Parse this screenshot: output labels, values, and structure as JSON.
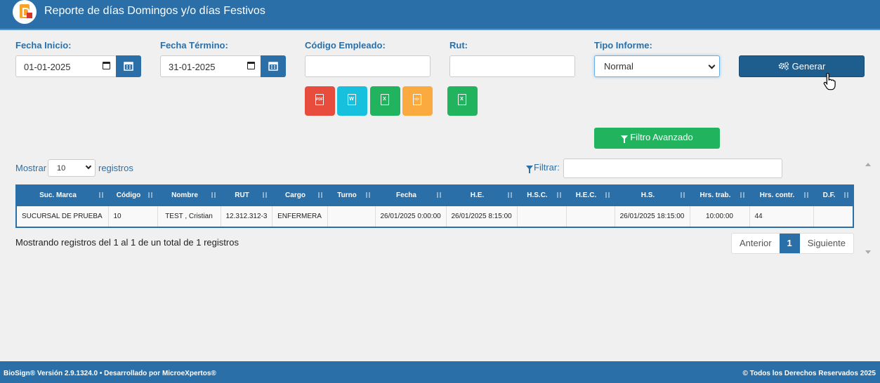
{
  "header": {
    "title": "Reporte de días Domingos y/o días Festivos"
  },
  "form": {
    "fecha_inicio": {
      "label": "Fecha Inicio:",
      "value": "01-01-2025"
    },
    "fecha_termino": {
      "label": "Fecha Término:",
      "value": "31-01-2025"
    },
    "codigo_empleado": {
      "label": "Código Empleado:",
      "value": ""
    },
    "rut": {
      "label": "Rut:",
      "value": ""
    },
    "tipo_informe": {
      "label": "Tipo Informe:",
      "selected": "Normal"
    },
    "generar_label": "Generar",
    "filtro_avanzado_label": "Filtro Avanzado"
  },
  "export_buttons": [
    {
      "name": "pdf-export-button",
      "glyph": "PDF",
      "color": "#e74c3c"
    },
    {
      "name": "word-export-button",
      "glyph": "W",
      "color": "#17c0dd"
    },
    {
      "name": "excel-export-button",
      "glyph": "X",
      "color": "#22b35e"
    },
    {
      "name": "xml-export-button",
      "glyph": "</>",
      "color": "#fbaa3f"
    },
    {
      "name": "excel-export-button-2",
      "glyph": "X",
      "color": "#22b35e"
    }
  ],
  "table_controls": {
    "mostrar": "Mostrar",
    "page_size": "10",
    "registros": "registros",
    "filtrar": "Filtrar:",
    "filtrar_value": ""
  },
  "table": {
    "columns": [
      "Suc. Marca",
      "Código",
      "Nombre",
      "RUT",
      "Cargo",
      "Turno",
      "Fecha",
      "H.E.",
      "H.S.C.",
      "H.E.C.",
      "H.S.",
      "Hrs. trab.",
      "Hrs. contr.",
      "D.F."
    ],
    "rows": [
      [
        "SUCURSAL DE PRUEBA",
        "10",
        "TEST , Cristian",
        "12.312.312-3",
        "ENFERMERA",
        "",
        "26/01/2025 0:00:00",
        "26/01/2025 8:15:00",
        "",
        "",
        "26/01/2025 18:15:00",
        "10:00:00",
        "44",
        ""
      ]
    ]
  },
  "pagination": {
    "info": "Mostrando registros del 1 al 1 de un total de 1 registros",
    "prev": "Anterior",
    "current": "1",
    "next": "Siguiente"
  },
  "footer": {
    "left": "BioSign® Versión 2.9.1324.0 • Desarrollado por MicroeXpertos®",
    "right": "© Todos los Derechos Reservados 2025"
  },
  "colors": {
    "primary": "#2a6fa8",
    "dark": "#1e5e8f",
    "success": "#22b35e"
  }
}
